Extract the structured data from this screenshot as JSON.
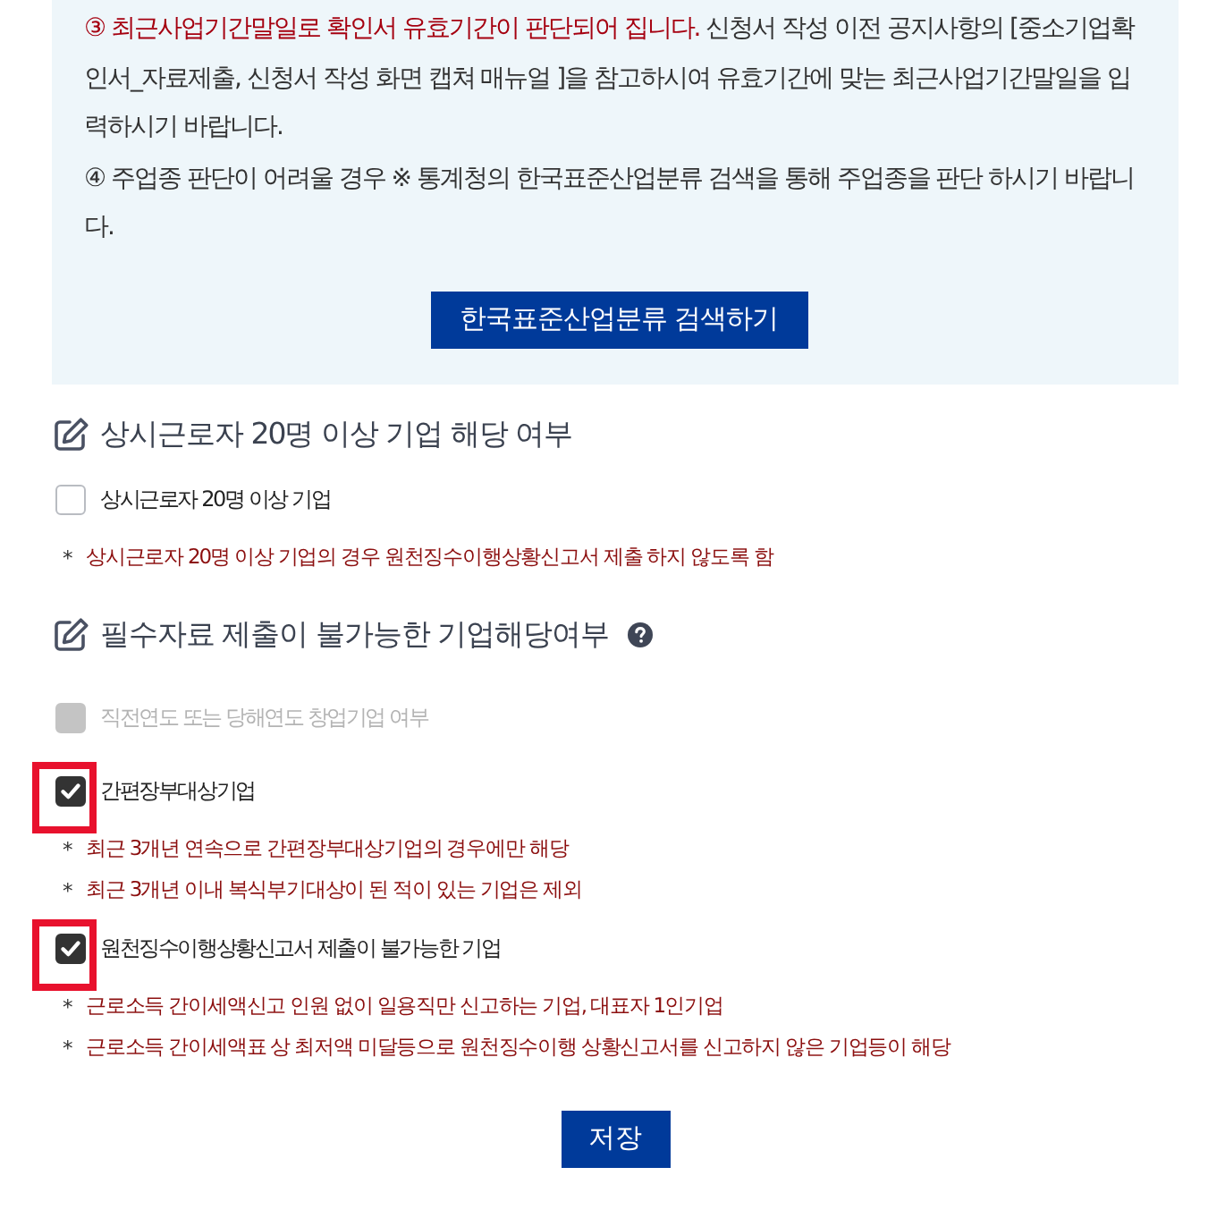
{
  "notice": {
    "paragraphs": [
      {
        "emphasis": "③ 최근사업기간말일로 확인서 유효기간이 판단되어 집니다.",
        "text": "신청서 작성 이전 공지사항의 [중소기업확인서_자료제출, 신청서 작성 화면 캡쳐 매뉴얼 ]을 참고하시여 유효기간에 맞는 최근사업기간말일을 입력하시기 바랍니다."
      },
      {
        "text": "④ 주업종 판단이 어려울 경우 ※ 통계청의 한국표준산업분류 검색을 통해 주업종을 판단 하시기 바랍니다."
      }
    ],
    "button": "한국표준산업분류 검색하기"
  },
  "sections": [
    {
      "title": "상시근로자 20명 이상 기업 해당 여부",
      "help": false,
      "options": [
        {
          "label": "상시근로자 20명 이상 기업",
          "checked": false,
          "disabled": false,
          "highlighted": false,
          "notes": [
            {
              "marker": "*",
              "text": "상시근로자 20명 이상 기업의 경우 원천징수이행상황신고서 제출 하지 않도록 함"
            }
          ]
        }
      ]
    },
    {
      "title": "필수자료 제출이 불가능한 기업해당여부",
      "help": true,
      "options": [
        {
          "label": "직전연도 또는 당해연도 창업기업 여부",
          "checked": false,
          "disabled": true,
          "highlighted": false
        },
        {
          "label": "간편장부대상기업",
          "checked": true,
          "disabled": false,
          "highlighted": true,
          "notes": [
            {
              "marker": "*",
              "text": "최근 3개년 연속으로 간편장부대상기업의 경우에만 해당"
            },
            {
              "marker": "*",
              "text": "최근 3개년 이내 복식부기대상이 된 적이 있는 기업은 제외"
            }
          ]
        },
        {
          "label": "원천징수이행상황신고서 제출이 불가능한 기업",
          "checked": true,
          "disabled": false,
          "highlighted": true,
          "notes": [
            {
              "marker": "*",
              "text": "근로소득 간이세액신고 인원 없이 일용직만 신고하는 기업, 대표자 1인기업"
            },
            {
              "marker": "*",
              "text": "근로소득 간이세액표 상 최저액 미달등으로 원천징수이행 상황신고서를 신고하지 않은 기업등이 해당"
            }
          ]
        }
      ]
    }
  ],
  "save_button": "저장"
}
